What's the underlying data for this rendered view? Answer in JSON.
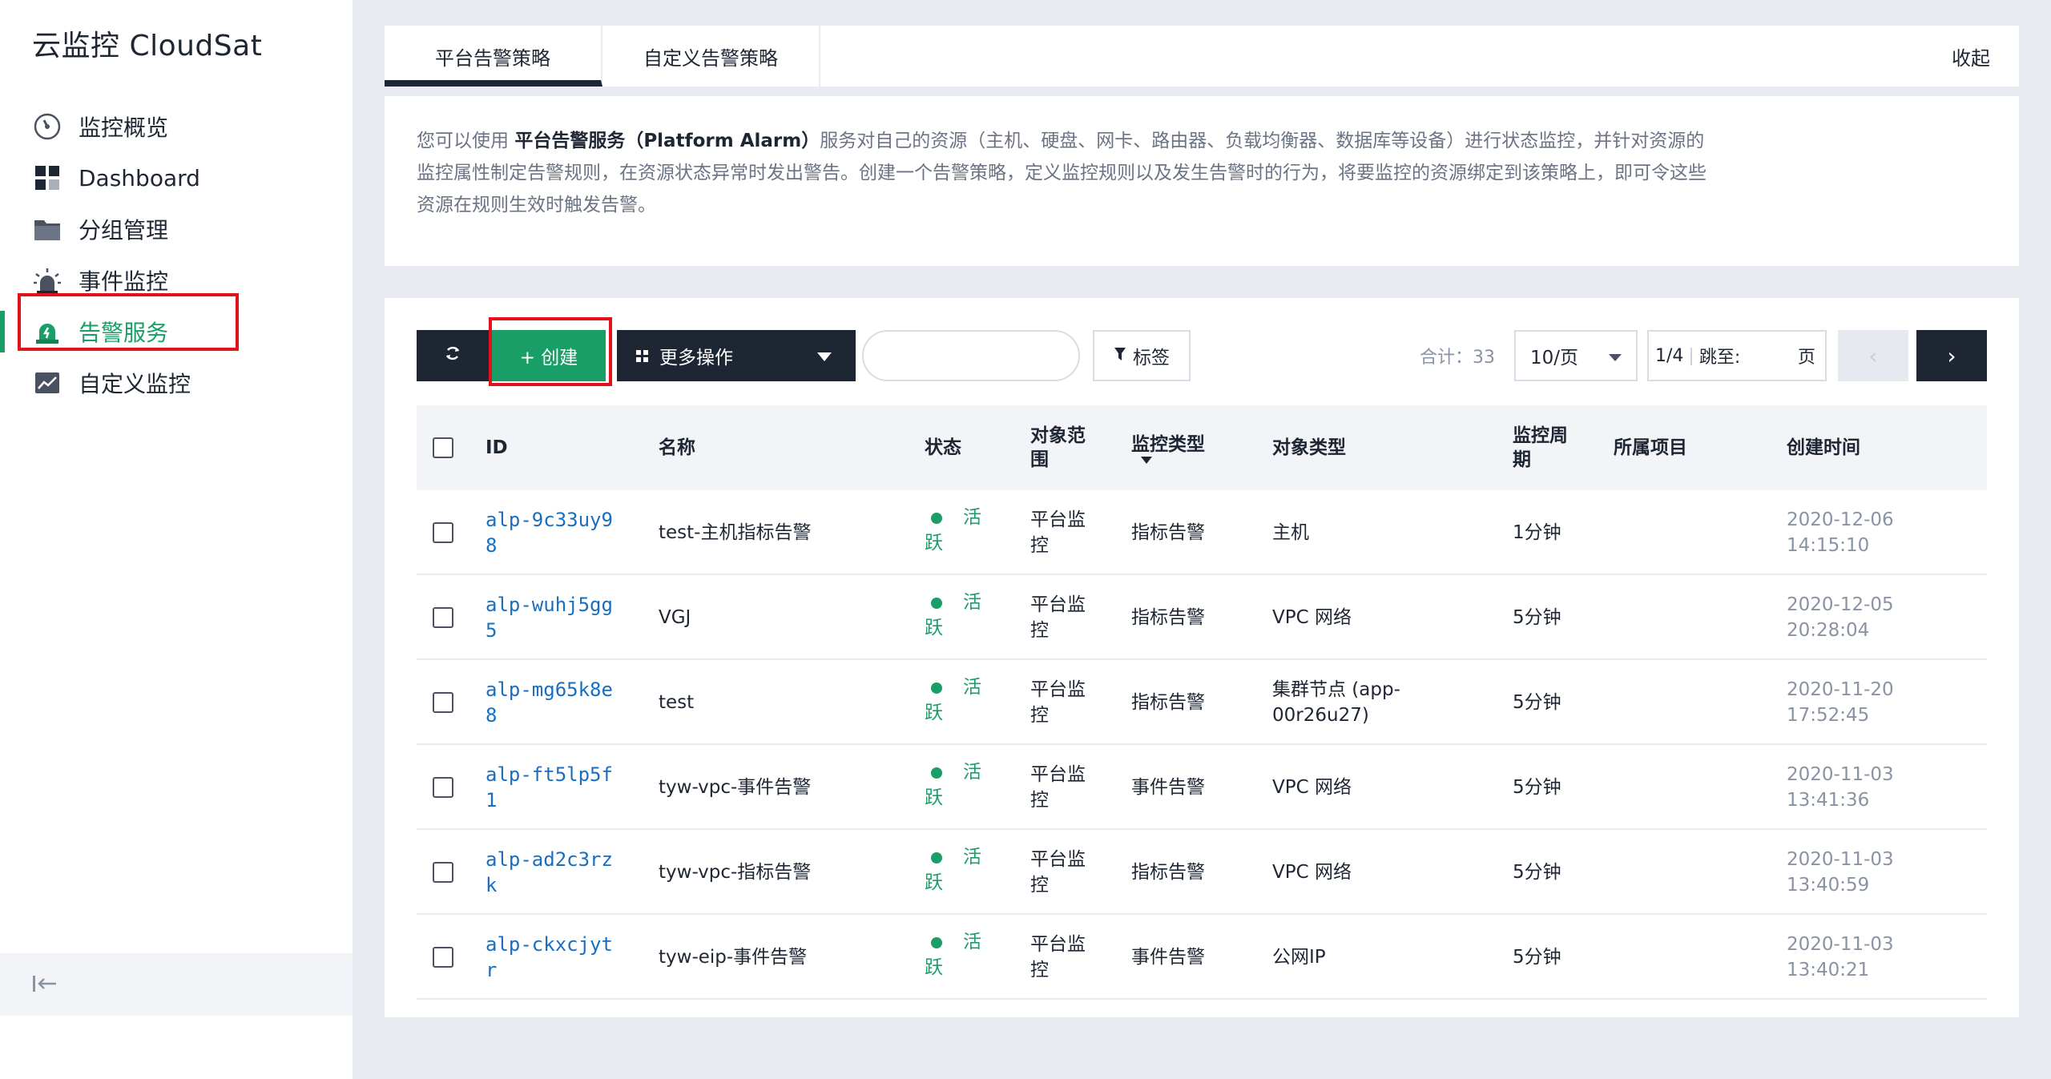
{
  "app": {
    "title": "云监控 CloudSat"
  },
  "sidebar": {
    "items": [
      {
        "label": "监控概览",
        "icon": "gauge-icon"
      },
      {
        "label": "Dashboard",
        "icon": "dashboard-icon"
      },
      {
        "label": "分组管理",
        "icon": "folder-icon"
      },
      {
        "label": "事件监控",
        "icon": "alarm-light-icon"
      },
      {
        "label": "告警服务",
        "icon": "alert-bell-icon",
        "active": true
      },
      {
        "label": "自定义监控",
        "icon": "trend-chart-icon"
      }
    ],
    "collapse_icon": "collapse-left-icon"
  },
  "tabs": [
    {
      "label": "平台告警策略",
      "active": true
    },
    {
      "label": "自定义告警策略",
      "active": false
    }
  ],
  "collapse_label": "收起",
  "description": {
    "prefix": "您可以使用 ",
    "strong": "平台告警服务（Platform Alarm）",
    "suffix": "服务对自己的资源（主机、硬盘、网卡、路由器、负载均衡器、数据库等设备）进行状态监控，并针对资源的监控属性制定告警规则，在资源状态异常时发出警告。创建一个告警策略，定义监控规则以及发生告警时的行为，将要监控的资源绑定到该策略上，即可令这些资源在规则生效时触发告警。"
  },
  "toolbar": {
    "refresh_icon": "refresh-icon",
    "create_label": "+ 创建",
    "more_label": "更多操作",
    "search_placeholder": "",
    "tag_label": "标签",
    "total_label": "合计：33",
    "page_size": "10/页",
    "page_info": "1/4",
    "jump_label": "跳至:",
    "page_unit": "页",
    "prev_icon": "‹",
    "next_icon": "›"
  },
  "table": {
    "headers": {
      "id": "ID",
      "name": "名称",
      "status": "状态",
      "scope": "对象范围",
      "monitor_type": "监控类型",
      "object_type": "对象类型",
      "period": "监控周期",
      "project": "所属项目",
      "created": "创建时间"
    },
    "rows": [
      {
        "id": "alp-9c33uy98",
        "name": "test-主机指标告警",
        "status": "活跃",
        "scope": "平台监控",
        "monitor_type": "指标告警",
        "object_type": "主机",
        "period": "1分钟",
        "project": "",
        "created": "2020-12-06 14:15:10"
      },
      {
        "id": "alp-wuhj5gg5",
        "name": "VGJ",
        "status": "活跃",
        "scope": "平台监控",
        "monitor_type": "指标告警",
        "object_type": "VPC 网络",
        "period": "5分钟",
        "project": "",
        "created": "2020-12-05 20:28:04"
      },
      {
        "id": "alp-mg65k8e8",
        "name": "test",
        "status": "活跃",
        "scope": "平台监控",
        "monitor_type": "指标告警",
        "object_type": "集群节点 (app-00r26u27)",
        "period": "5分钟",
        "project": "",
        "created": "2020-11-20 17:52:45"
      },
      {
        "id": "alp-ft5lp5f1",
        "name": "tyw-vpc-事件告警",
        "status": "活跃",
        "scope": "平台监控",
        "monitor_type": "事件告警",
        "object_type": "VPC 网络",
        "period": "5分钟",
        "project": "",
        "created": "2020-11-03 13:41:36"
      },
      {
        "id": "alp-ad2c3rzk",
        "name": "tyw-vpc-指标告警",
        "status": "活跃",
        "scope": "平台监控",
        "monitor_type": "指标告警",
        "object_type": "VPC 网络",
        "period": "5分钟",
        "project": "",
        "created": "2020-11-03 13:40:59"
      },
      {
        "id": "alp-ckxcjytr",
        "name": "tyw-eip-事件告警",
        "status": "活跃",
        "scope": "平台监控",
        "monitor_type": "事件告警",
        "object_type": "公网IP",
        "period": "5分钟",
        "project": "",
        "created": "2020-11-03 13:40:21"
      }
    ]
  },
  "colors": {
    "accent": "#1a9e68",
    "dark": "#1f2633",
    "link": "#1a6ec0",
    "highlight": "#e3111c"
  }
}
